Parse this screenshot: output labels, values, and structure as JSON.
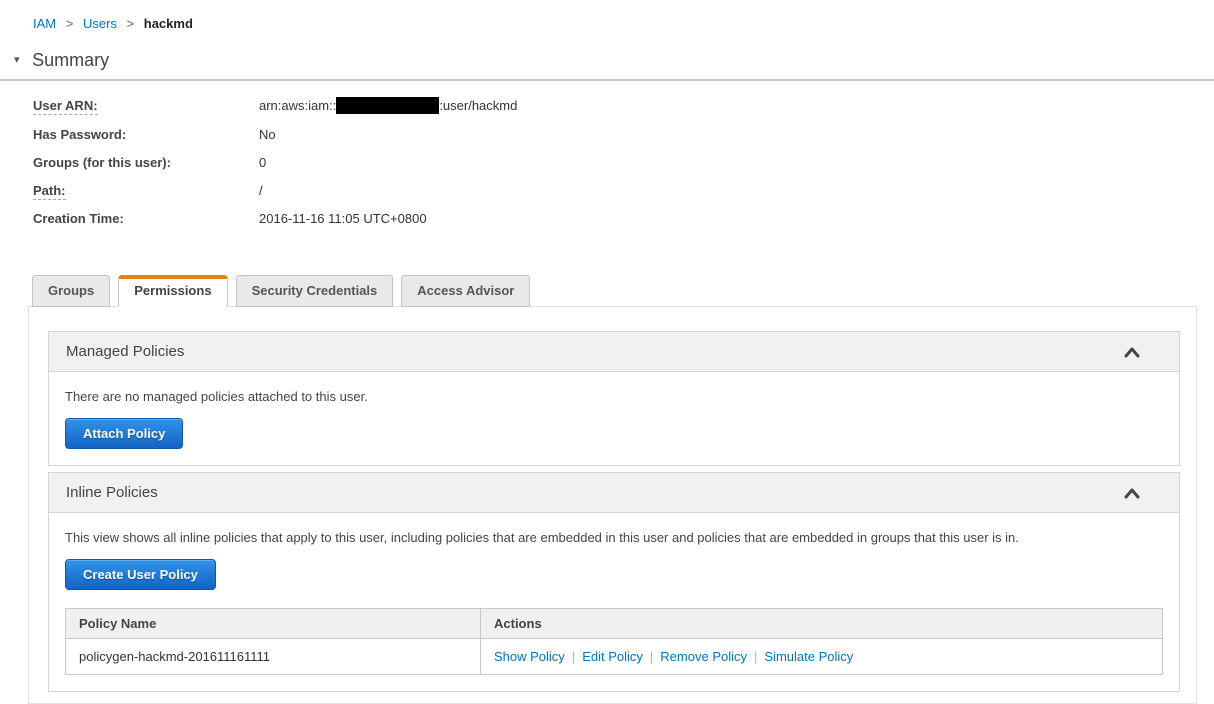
{
  "breadcrumb": {
    "separator": ">",
    "items": [
      {
        "label": "IAM"
      },
      {
        "label": "Users"
      },
      {
        "label": "hackmd"
      }
    ]
  },
  "summary": {
    "title": "Summary",
    "collapse_icon": "▾",
    "fields": {
      "user_arn": {
        "label": "User ARN:",
        "value_prefix": "arn:aws:iam::",
        "redacted_segment": "account-id-hidden",
        "value_suffix": ":user/hackmd"
      },
      "has_password": {
        "label": "Has Password:",
        "value": "No"
      },
      "groups": {
        "label": "Groups (for this user):",
        "value": "0"
      },
      "path": {
        "label": "Path:",
        "value": "/"
      },
      "creation_time": {
        "label": "Creation Time:",
        "value": "2016-11-16 11:05 UTC+0800"
      }
    }
  },
  "tabs": [
    {
      "label": "Groups",
      "active": false
    },
    {
      "label": "Permissions",
      "active": true
    },
    {
      "label": "Security Credentials",
      "active": false
    },
    {
      "label": "Access Advisor",
      "active": false
    }
  ],
  "managed_policies": {
    "title": "Managed Policies",
    "empty_message": "There are no managed policies attached to this user.",
    "attach_button_label": "Attach Policy"
  },
  "inline_policies": {
    "title": "Inline Policies",
    "description": "This view shows all inline policies that apply to this user, including policies that are embedded in this user and policies that are embedded in groups that this user is in.",
    "create_button_label": "Create User Policy",
    "action_separator": "|",
    "table": {
      "headers": [
        "Policy Name",
        "Actions"
      ],
      "rows": [
        {
          "policy_name": "policygen-hackmd-201611161111",
          "actions": [
            "Show Policy",
            "Edit Policy",
            "Remove Policy",
            "Simulate Policy"
          ]
        }
      ]
    }
  },
  "colors": {
    "link_blue": "#0073bb",
    "active_tab_orange": "#e8820c",
    "button_gradient_top": "#2f93e8",
    "button_gradient_bottom": "#1464c3"
  }
}
